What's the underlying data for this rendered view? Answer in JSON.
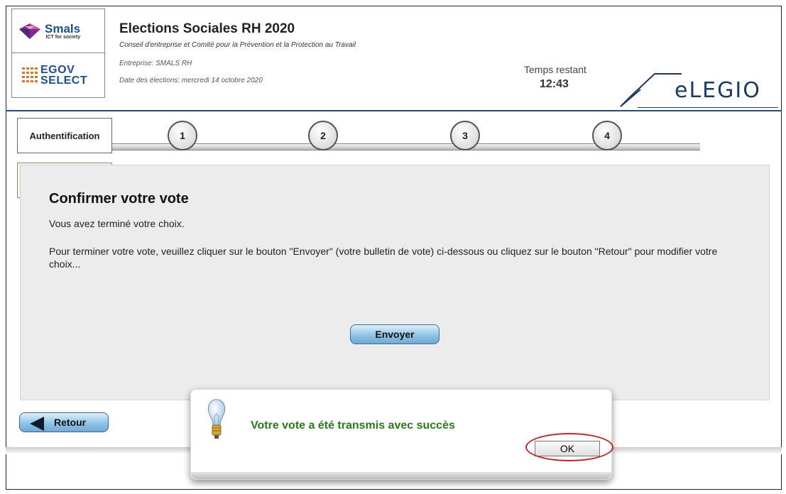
{
  "header": {
    "logo_smals": {
      "name": "Smals",
      "tagline": "ICT for society"
    },
    "logo_egov": {
      "line1": "EGOV",
      "line2": "SELECT"
    },
    "title": "Elections Sociales RH 2020",
    "subtitle": "Conseil d'entreprise et Comité pour la Prévention et la Protection au Travail",
    "company": "Entreprise: SMALS RH",
    "date": "Date des élections: mercredi 14 octobre 2020",
    "timer_label": "Temps restant",
    "timer_value": "12:43",
    "brand": "eLEGIO"
  },
  "steps": {
    "auth_tab": "Authentification",
    "items": [
      "1",
      "2",
      "3",
      "4"
    ]
  },
  "panel": {
    "title": "Confirmer votre vote",
    "line1": "Vous avez terminé votre choix.",
    "line2": "Pour terminer votre vote, veuillez cliquer sur le bouton \"Envoyer\" (votre bulletin de vote) ci-dessous ou cliquez sur le bouton \"Retour\" pour modifier votre choix...",
    "send_label": "Envoyer"
  },
  "back_label": "Retour",
  "modal": {
    "message": "Votre vote a été transmis avec succès",
    "ok_label": "OK",
    "icon": "lightbulb-icon"
  },
  "colors": {
    "accent_blue": "#1d4e95",
    "success_green": "#2a7a1a",
    "highlight_red": "#d41f1f",
    "button_blue": "#8fc4e7"
  }
}
